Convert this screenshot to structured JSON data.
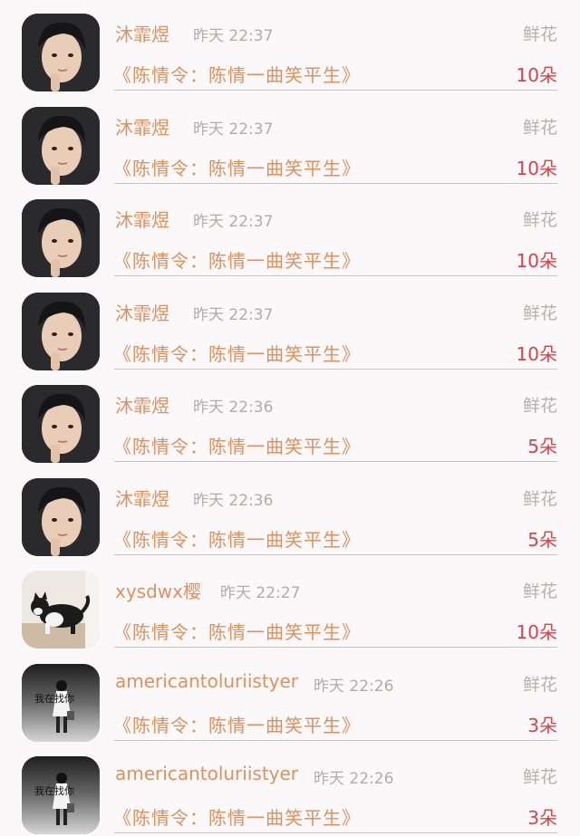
{
  "items": [
    {
      "username": "沐霏煜",
      "time": "昨天 22:37",
      "gift_type": "鲜花",
      "book_title": "《陈情令：陈情一曲笑平生》",
      "gift_count": "10朵",
      "avatar": "portrait-male-icon"
    },
    {
      "username": "沐霏煜",
      "time": "昨天 22:37",
      "gift_type": "鲜花",
      "book_title": "《陈情令：陈情一曲笑平生》",
      "gift_count": "10朵",
      "avatar": "portrait-male-icon"
    },
    {
      "username": "沐霏煜",
      "time": "昨天 22:37",
      "gift_type": "鲜花",
      "book_title": "《陈情令：陈情一曲笑平生》",
      "gift_count": "10朵",
      "avatar": "portrait-male-icon"
    },
    {
      "username": "沐霏煜",
      "time": "昨天 22:37",
      "gift_type": "鲜花",
      "book_title": "《陈情令：陈情一曲笑平生》",
      "gift_count": "10朵",
      "avatar": "portrait-male-icon"
    },
    {
      "username": "沐霏煜",
      "time": "昨天 22:36",
      "gift_type": "鲜花",
      "book_title": "《陈情令：陈情一曲笑平生》",
      "gift_count": "5朵",
      "avatar": "portrait-male-icon"
    },
    {
      "username": "沐霏煜",
      "time": "昨天 22:36",
      "gift_type": "鲜花",
      "book_title": "《陈情令：陈情一曲笑平生》",
      "gift_count": "5朵",
      "avatar": "portrait-male-icon"
    },
    {
      "username": "xysdwx樱",
      "time": "昨天 22:27",
      "gift_type": "鲜花",
      "book_title": "《陈情令：陈情一曲笑平生》",
      "gift_count": "10朵",
      "avatar": "cat-icon"
    },
    {
      "username": "americantoluriistyer",
      "time": "昨天 22:26",
      "gift_type": "鲜花",
      "book_title": "《陈情令：陈情一曲笑平生》",
      "gift_count": "3朵",
      "avatar": "girl-bw-icon",
      "avatar_text": "我在找你"
    },
    {
      "username": "americantoluriistyer",
      "time": "昨天 22:26",
      "gift_type": "鲜花",
      "book_title": "《陈情令：陈情一曲笑平生》",
      "gift_count": "3朵",
      "avatar": "girl-bw-icon",
      "avatar_text": "我在找你"
    }
  ],
  "colors": {
    "accent": "#e0905e",
    "count": "#d8434a",
    "muted": "#b0acac",
    "divider": "#c9c5c5",
    "background": "#faf8f8"
  }
}
